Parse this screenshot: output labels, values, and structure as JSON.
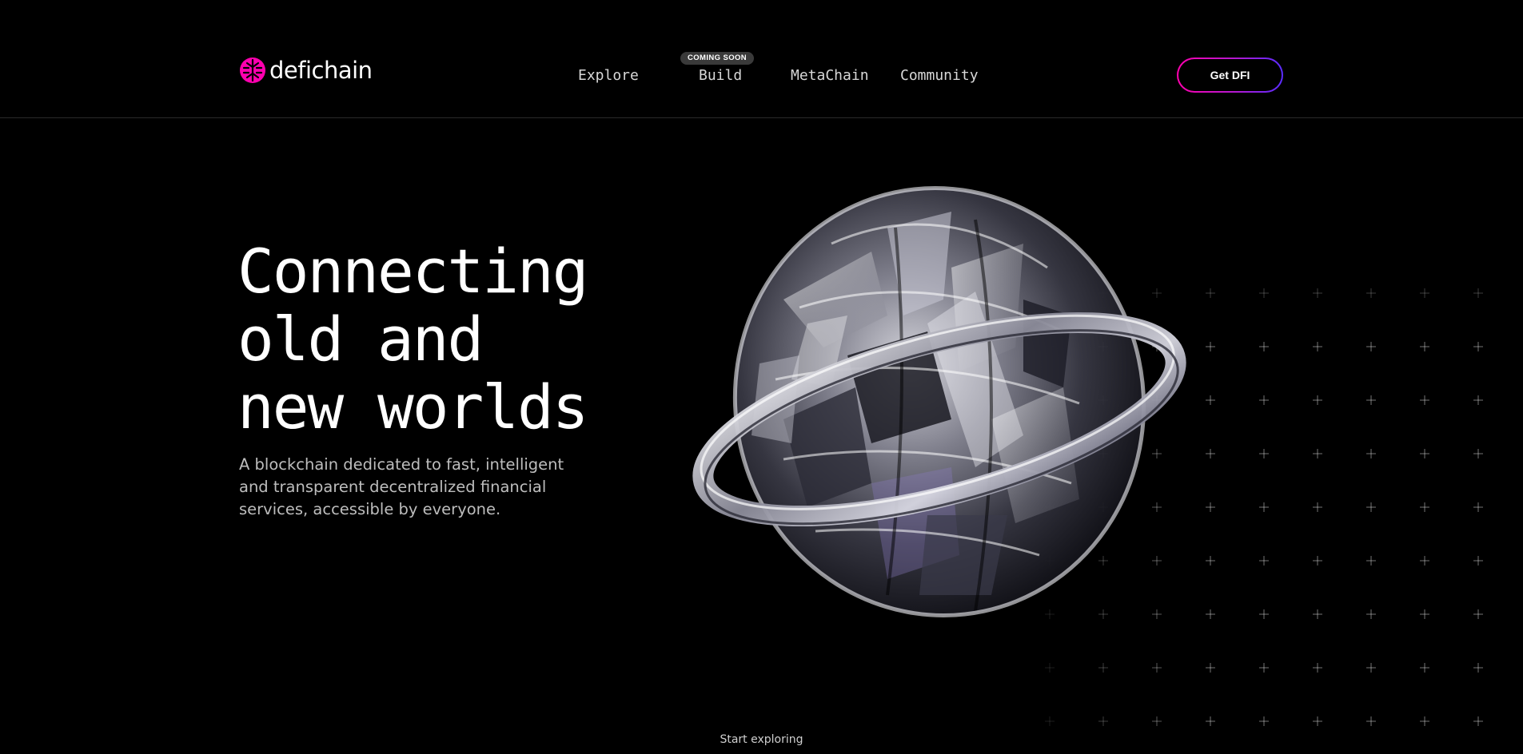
{
  "brand": {
    "name": "defichain",
    "accent_color": "#ff00af",
    "gradient_end": "#5a2cff"
  },
  "nav": {
    "items": [
      {
        "label": "Explore"
      },
      {
        "label": "Build",
        "badge": "COMING SOON"
      },
      {
        "label": "MetaChain"
      },
      {
        "label": "Community"
      }
    ]
  },
  "cta": {
    "label": "Get DFI"
  },
  "hero": {
    "title_lines": [
      "Connecting",
      "old and",
      "new worlds"
    ],
    "subtitle_lines": [
      "A blockchain dedicated to fast, intelligent",
      "and transparent decentralized financial",
      "services, accessible by everyone."
    ],
    "scroll_hint": "Start exploring"
  },
  "icons": {
    "logo": "defichain-logo-icon",
    "orb": "glass-sphere-ring-illustration",
    "grid": "plus-pattern-icon"
  }
}
